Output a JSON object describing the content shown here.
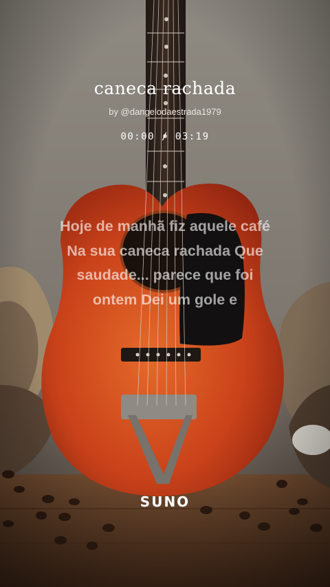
{
  "song": {
    "title": "caneca rachada",
    "byline": "by @dangelodaestrada1979",
    "time": "00:00 / 03:19"
  },
  "lyrics": [
    "Hoje de manhã fiz aquele café",
    "Na sua caneca rachada Que",
    "saudade... parece que foi",
    "ontem Dei um gole e"
  ],
  "brand": {
    "logo_text": "SUNO"
  },
  "colors": {
    "wall": "#8d8880",
    "guitar_body": "#cf4a1c",
    "pickguard": "#121010",
    "table": "#6b4428"
  }
}
